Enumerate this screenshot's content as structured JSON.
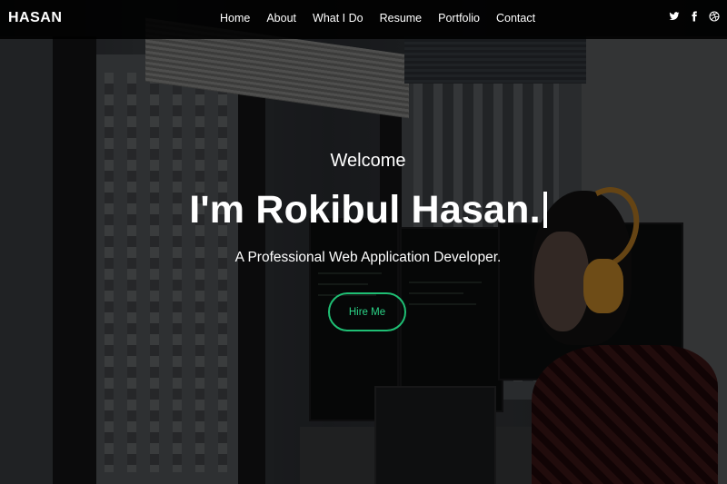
{
  "brand": {
    "logo": "HASAN"
  },
  "nav": {
    "items": [
      {
        "label": "Home"
      },
      {
        "label": "About"
      },
      {
        "label": "What I Do"
      },
      {
        "label": "Resume"
      },
      {
        "label": "Portfolio"
      },
      {
        "label": "Contact"
      }
    ]
  },
  "social": {
    "icons": [
      "twitter-icon",
      "facebook-icon",
      "dribbble-icon"
    ]
  },
  "hero": {
    "welcome": "Welcome",
    "headline": "I'm Rokibul Hasan.",
    "subtitle": "A Professional Web Application Developer.",
    "cta_label": "Hire Me"
  },
  "colors": {
    "accent": "#1fbf74",
    "navbar_bg": "#000000",
    "text": "#ffffff"
  }
}
